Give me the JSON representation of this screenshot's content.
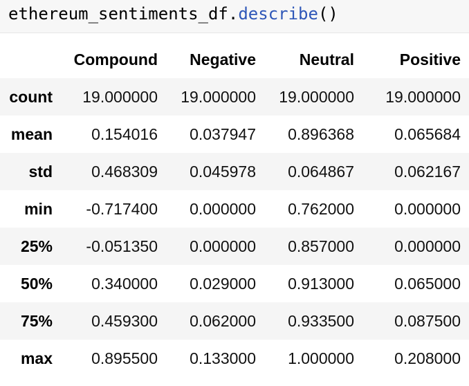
{
  "code_cell": {
    "object": "ethereum_sentiments_df",
    "dot": ".",
    "method": "describe",
    "parens": "()"
  },
  "table": {
    "columns": [
      "Compound",
      "Negative",
      "Neutral",
      "Positive"
    ],
    "rows": [
      {
        "label": "count",
        "values": [
          "19.000000",
          "19.000000",
          "19.000000",
          "19.000000"
        ]
      },
      {
        "label": "mean",
        "values": [
          "0.154016",
          "0.037947",
          "0.896368",
          "0.065684"
        ]
      },
      {
        "label": "std",
        "values": [
          "0.468309",
          "0.045978",
          "0.064867",
          "0.062167"
        ]
      },
      {
        "label": "min",
        "values": [
          "-0.717400",
          "0.000000",
          "0.762000",
          "0.000000"
        ]
      },
      {
        "label": "25%",
        "values": [
          "-0.051350",
          "0.000000",
          "0.857000",
          "0.000000"
        ]
      },
      {
        "label": "50%",
        "values": [
          "0.340000",
          "0.029000",
          "0.913000",
          "0.065000"
        ]
      },
      {
        "label": "75%",
        "values": [
          "0.459300",
          "0.062000",
          "0.933500",
          "0.087500"
        ]
      },
      {
        "label": "max",
        "values": [
          "0.895500",
          "0.133000",
          "1.000000",
          "0.208000"
        ]
      }
    ]
  },
  "colors": {
    "code_background": "#f7f7f7",
    "function_name": "#2f57b8",
    "stripe_row": "#f5f5f5"
  }
}
